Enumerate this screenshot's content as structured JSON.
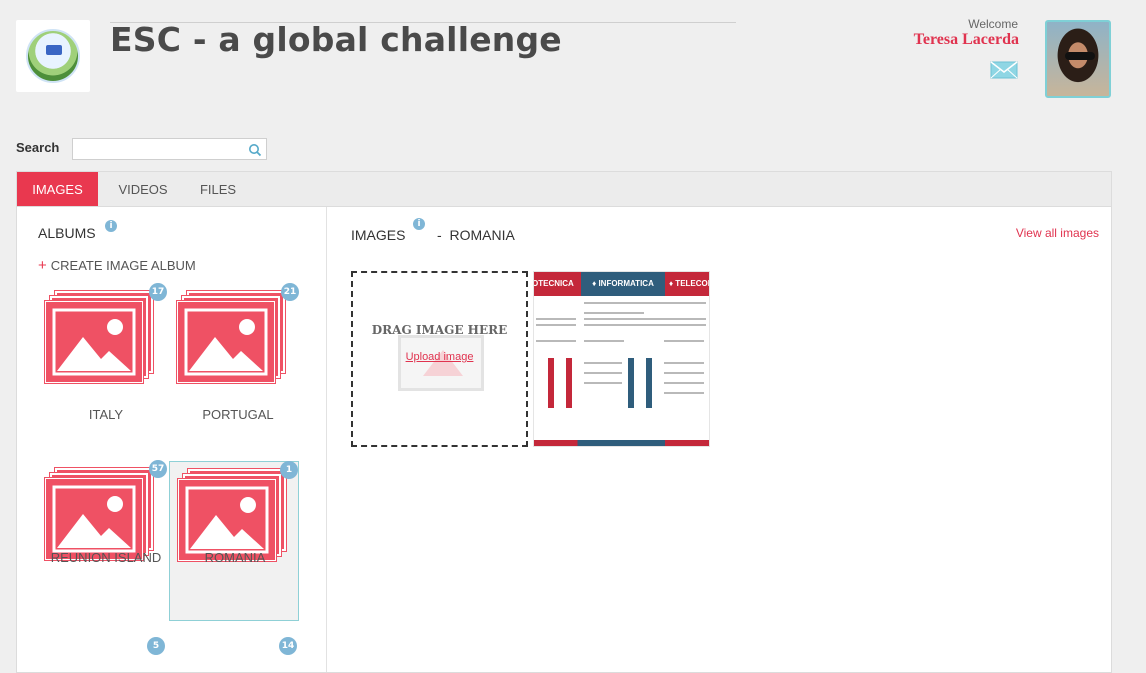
{
  "header": {
    "title": "ESC - a global challenge",
    "welcome": "Welcome",
    "username": "Teresa Lacerda"
  },
  "search": {
    "label": "Search",
    "value": "",
    "placeholder": ""
  },
  "tabs": [
    {
      "label": "IMAGES",
      "active": true
    },
    {
      "label": "VIDEOS",
      "active": false
    },
    {
      "label": "FILES",
      "active": false
    }
  ],
  "albums": {
    "title": "ALBUMS",
    "create_label": "CREATE IMAGE ALBUM",
    "items": [
      {
        "name": "ITALY",
        "count": "17",
        "selected": false
      },
      {
        "name": "PORTUGAL",
        "count": "21",
        "selected": false
      },
      {
        "name": "REUNION ISLAND",
        "count": "57",
        "selected": false
      },
      {
        "name": "ROMANIA",
        "count": "1",
        "selected": true
      }
    ],
    "partial_badges": [
      "5",
      "14"
    ]
  },
  "images": {
    "title": "IMAGES",
    "separator": "-",
    "album": "ROMANIA",
    "view_all": "View all images",
    "drag_text": "DRAG IMAGE HERE",
    "upload_link": "Upload image",
    "thumb_labels": [
      "OTECNICA",
      "♦ INFORMATICA",
      "♦ TELECOMU"
    ]
  },
  "colors": {
    "accent": "#e9384f",
    "badge": "#7fb6d6",
    "album": "#ef5164"
  }
}
